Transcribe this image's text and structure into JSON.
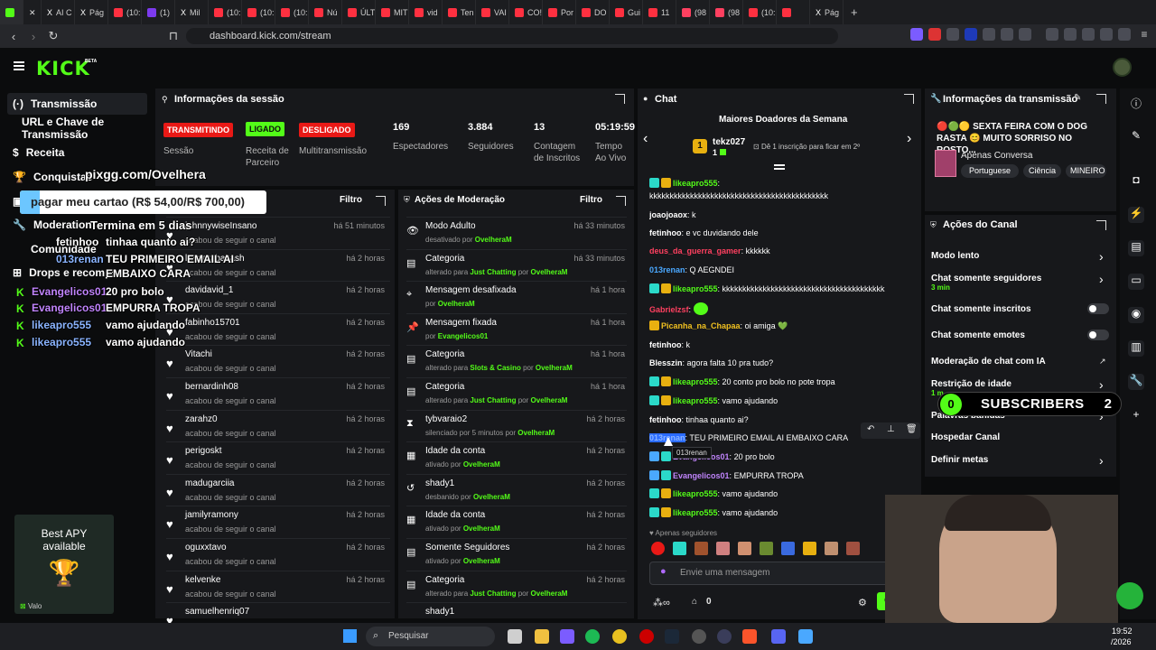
{
  "browser": {
    "tabs": [
      {
        "label": "",
        "c": "#53fc18",
        "active": true
      },
      {
        "label": "",
        "c": "#2b2c30",
        "close": "✕"
      },
      {
        "label": "AI C",
        "c": "#ffffff",
        "x": "X"
      },
      {
        "label": "Pág",
        "c": "#ffffff",
        "x": "X"
      },
      {
        "label": "(10:",
        "c": "#ff3040"
      },
      {
        "label": "(1)",
        "c": "#7c3aed"
      },
      {
        "label": "Mil",
        "c": "#ffffff",
        "x": "X"
      },
      {
        "label": "(10:",
        "c": "#ff3040"
      },
      {
        "label": "(10:",
        "c": "#ff3040"
      },
      {
        "label": "(10:",
        "c": "#ff3040"
      },
      {
        "label": "Nú",
        "c": "#ff3040"
      },
      {
        "label": "ÚLT",
        "c": "#ff3040"
      },
      {
        "label": "MIT",
        "c": "#ff3040"
      },
      {
        "label": "vid",
        "c": "#ff3040"
      },
      {
        "label": "Ten",
        "c": "#ff3040"
      },
      {
        "label": "VAI",
        "c": "#ff3040"
      },
      {
        "label": "CO!",
        "c": "#ff3040"
      },
      {
        "label": "Por",
        "c": "#ff3040"
      },
      {
        "label": "DO",
        "c": "#ff3040"
      },
      {
        "label": "Gui",
        "c": "#ff3040"
      },
      {
        "label": "11",
        "c": "#ff3040"
      },
      {
        "label": "(98",
        "c": "#ff4060"
      },
      {
        "label": "(98",
        "c": "#ff4060"
      },
      {
        "label": "(10:",
        "c": "#ff3040"
      },
      {
        "label": "",
        "c": "#ff3040"
      },
      {
        "label": "Pág",
        "c": "#ffffff",
        "x": "X"
      }
    ],
    "new_tab": "+",
    "url": "dashboard.kick.com/stream"
  },
  "kick": {
    "logo": "KICK",
    "beta": "BETA"
  },
  "sidebar": {
    "items": [
      {
        "label": "Transmissão",
        "icon": "(·)"
      },
      {
        "label": "URL e Chave de Transmissão",
        "icon": ""
      },
      {
        "label": "Receita",
        "icon": "$"
      },
      {
        "label": "Conquistas",
        "icon": "🏆"
      },
      {
        "label": "",
        "icon": "▣"
      },
      {
        "label": "Moderation",
        "icon": "🔧"
      },
      {
        "label": "Comunidade",
        "icon": ""
      },
      {
        "label": "Drops e recompe",
        "icon": "⊞"
      }
    ]
  },
  "overlay": {
    "link": "pixgg.com/Ovelhera",
    "goal": "pagar meu cartao (R$ 54,00/R$ 700,00)",
    "ends": "Termina em 5 dias",
    "chat": [
      {
        "user": "fetinhoo",
        "msg": "tinhaa quanto ai?",
        "color": "#ffffff"
      },
      {
        "user": "013renan",
        "msg": "TEU PRIMEIRO EMAIL AI",
        "color": "#8ab4ff"
      },
      {
        "user": "",
        "msg": "EMBAIXO CARA",
        "color": "#ffffff"
      },
      {
        "user": "Evangelicos01",
        "msg": "20 pro bolo",
        "color": "#c084fc"
      },
      {
        "user": "Evangelicos01",
        "msg": "EMPURRA TROPA",
        "color": "#c084fc"
      },
      {
        "user": "likeapro555",
        "msg": "vamo ajudando",
        "color": "#8ab4ff"
      },
      {
        "user": "likeapro555",
        "msg": "vamo ajudando",
        "color": "#8ab4ff"
      }
    ],
    "apy_line1": "Best APY",
    "apy_line2": "available",
    "valo": "Valo",
    "viewers": "169",
    "sub_count_left": "0",
    "sub_label": "SUBSCRIBERS",
    "sub_count_right": "2"
  },
  "session": {
    "title": "Informações da sessão",
    "badges": {
      "live": "TRANSMITINDO",
      "on": "LIGADO",
      "off": "DESLIGADO"
    },
    "labels": {
      "session": "Sessão",
      "partner": "Receita de Parceiro",
      "multi": "Multitransmissão"
    },
    "stats": [
      {
        "value": "169",
        "label": "Espectadores"
      },
      {
        "value": "3.884",
        "label": "Seguidores"
      },
      {
        "value": "13",
        "label": "Contagem de Inscritos"
      },
      {
        "value": "05:19:59",
        "label": "Tempo Ao Vivo"
      }
    ]
  },
  "followers": {
    "filter": "Filtro",
    "rows": [
      {
        "name": "johnnywiseInsano",
        "sub": "acabou de seguir o canal",
        "time": "há 51 minutos"
      },
      {
        "name": "lanaarabakash",
        "sub": "acabou de seguir o canal",
        "time": "há 2 horas"
      },
      {
        "name": "davidavid_1",
        "sub": "acabou de seguir o canal",
        "time": "há 2 horas"
      },
      {
        "name": "fabinho15701",
        "sub": "acabou de seguir o canal",
        "time": "há 2 horas"
      },
      {
        "name": "Vitachi",
        "sub": "acabou de seguir o canal",
        "time": "há 2 horas"
      },
      {
        "name": "bernardinh08",
        "sub": "acabou de seguir o canal",
        "time": "há 2 horas"
      },
      {
        "name": "zarahz0",
        "sub": "acabou de seguir o canal",
        "time": "há 2 horas"
      },
      {
        "name": "perigoskt",
        "sub": "acabou de seguir o canal",
        "time": "há 2 horas"
      },
      {
        "name": "madugarciia",
        "sub": "acabou de seguir o canal",
        "time": "há 2 horas"
      },
      {
        "name": "jamilyramony",
        "sub": "acabou de seguir o canal",
        "time": "há 2 horas"
      },
      {
        "name": "oguxxtavo",
        "sub": "acabou de seguir o canal",
        "time": "há 2 horas"
      },
      {
        "name": "kelvenke",
        "sub": "acabou de seguir o canal",
        "time": "há 2 horas"
      },
      {
        "name": "samuelhenriq07",
        "sub": "",
        "time": ""
      }
    ]
  },
  "moderation": {
    "title": "Ações de Moderação",
    "filter": "Filtro",
    "rows": [
      {
        "icon": "👁",
        "name": "Modo Adulto",
        "pre": "desativado por",
        "hl": "",
        "mid": "",
        "by": "OvelheraM",
        "time": "há 33 minutos"
      },
      {
        "icon": "▤",
        "name": "Categoria",
        "pre": "alterado para",
        "hl": "Just Chatting",
        "mid": "por",
        "by": "OvelheraM",
        "time": "há 33 minutos"
      },
      {
        "icon": "⌖",
        "name": "Mensagem desafixada",
        "pre": "por",
        "hl": "",
        "mid": "",
        "by": "OvelheraM",
        "time": "há 1 hora"
      },
      {
        "icon": "📌",
        "name": "Mensagem fixada",
        "pre": "por",
        "hl": "",
        "mid": "",
        "by": "Evangelicos01",
        "time": "há 1 hora"
      },
      {
        "icon": "▤",
        "name": "Categoria",
        "pre": "alterado para",
        "hl": "Slots & Casino",
        "mid": "por",
        "by": "OvelheraM",
        "time": "há 1 hora"
      },
      {
        "icon": "▤",
        "name": "Categoria",
        "pre": "alterado para",
        "hl": "Just Chatting",
        "mid": "por",
        "by": "OvelheraM",
        "time": "há 1 hora"
      },
      {
        "icon": "⧗",
        "name": "tybvaraio2",
        "pre": "silenciado por 5 minutos por",
        "hl": "",
        "mid": "",
        "by": "OvelheraM",
        "time": "há 2 horas"
      },
      {
        "icon": "▦",
        "name": "Idade da conta",
        "pre": "ativado por",
        "hl": "",
        "mid": "",
        "by": "OvelheraM",
        "time": "há 2 horas"
      },
      {
        "icon": "↺",
        "name": "shady1",
        "pre": "desbanido por",
        "hl": "",
        "mid": "",
        "by": "OvelheraM",
        "time": "há 2 horas"
      },
      {
        "icon": "▦",
        "name": "Idade da conta",
        "pre": "ativado por",
        "hl": "",
        "mid": "",
        "by": "OvelheraM",
        "time": "há 2 horas"
      },
      {
        "icon": "▤",
        "name": "Somente Seguidores",
        "pre": "ativado por",
        "hl": "",
        "mid": "",
        "by": "OvelheraM",
        "time": "há 2 horas"
      },
      {
        "icon": "▤",
        "name": "Categoria",
        "pre": "alterado para",
        "hl": "Just Chatting",
        "mid": "por",
        "by": "OvelheraM",
        "time": "há 2 horas"
      },
      {
        "icon": "",
        "name": "shady1",
        "pre": "",
        "hl": "",
        "mid": "",
        "by": "",
        "time": ""
      }
    ]
  },
  "chat": {
    "title": "Chat",
    "donors_title": "Maiores Doadores da Semana",
    "donor_rank": "1",
    "donor_name": "tekz027",
    "donor_count": "1",
    "donor_info": "Dê 1 inscrição para ficar em 2º",
    "messages": [
      {
        "user": "likeapro555",
        "color": "#53fc18",
        "badges": [
          "#2bd9c9",
          "#e8b010"
        ],
        "text": ""
      },
      {
        "user": "",
        "color": "#fff",
        "badges": [],
        "text": "kkkkkkkkkkkkkkkkkkkkkkkkkkkkkkkkkkkkkkkkkkkk"
      },
      {
        "user": "joaojoaox",
        "color": "#ffffff",
        "badges": [],
        "text": "k"
      },
      {
        "user": "fetinhoo",
        "color": "#ffffff",
        "badges": [],
        "text": "e vc duvidando dele"
      },
      {
        "user": "deus_da_guerra_gamer",
        "color": "#ff4060",
        "badges": [],
        "text": "kkkkkk"
      },
      {
        "user": "013renan",
        "color": "#4aa8ff",
        "badges": [],
        "text": "Q AEGNDEI"
      },
      {
        "user": "likeapro555",
        "color": "#53fc18",
        "badges": [
          "#2bd9c9",
          "#e8b010"
        ],
        "text": "kkkkkkkkkkkkkkkkkkkkkkkkkkkkkkkkkkkkkkkk"
      },
      {
        "user": "Gabrielzsf",
        "color": "#ff4060",
        "badges": [],
        "text": ""
      },
      {
        "user": "Picanha_na_Chapaa",
        "color": "#f0c020",
        "badges": [
          "#e8b010"
        ],
        "text": "oi amiga 💚"
      },
      {
        "user": "fetinhoo",
        "color": "#ffffff",
        "badges": [],
        "text": "k"
      },
      {
        "user": "Blesszin",
        "color": "#ffffff",
        "badges": [],
        "text": "agora falta 10 pra tudo?"
      },
      {
        "user": "likeapro555",
        "color": "#53fc18",
        "badges": [
          "#2bd9c9",
          "#e8b010"
        ],
        "text": "20 conto pro bolo no pote tropa"
      },
      {
        "user": "likeapro555",
        "color": "#53fc18",
        "badges": [
          "#2bd9c9",
          "#e8b010"
        ],
        "text": "vamo ajudando"
      },
      {
        "user": "fetinhoo",
        "color": "#ffffff",
        "badges": [],
        "text": "tinhaa quanto ai?"
      },
      {
        "user": "013renan",
        "color": "#4aa8ff",
        "badges": [],
        "text": "TEU PRIMEIRO EMAIL AI EMBAIXO CARA"
      },
      {
        "user": "Evangelicos01",
        "color": "#c084fc",
        "badges": [
          "#4aa8ff",
          "#2bd9c9"
        ],
        "text": "20 pro bolo"
      },
      {
        "user": "Evangelicos01",
        "color": "#c084fc",
        "badges": [
          "#4aa8ff",
          "#2bd9c9"
        ],
        "text": "EMPURRA TROPA"
      },
      {
        "user": "likeapro555",
        "color": "#53fc18",
        "badges": [
          "#2bd9c9",
          "#e8b010"
        ],
        "text": "vamo ajudando"
      },
      {
        "user": "likeapro555",
        "color": "#53fc18",
        "badges": [
          "#2bd9c9",
          "#e8b010"
        ],
        "text": "vamo ajudando"
      }
    ],
    "tooltip": "013renan",
    "emotes_label": "Apenas seguidores",
    "placeholder": "Envie uma mensagem",
    "points": "0",
    "send": "Chat"
  },
  "stream_info": {
    "title": "Informações da transmissão",
    "stream_title": "🔴🟢🟡 SEXTA FEIRA COM O DOG RASTA 😊 MUITO SORRISO NO ROSTO...",
    "category": "Apenas Conversa",
    "tags": [
      "Portuguese",
      "Ciência",
      "MINEIRO"
    ]
  },
  "channel_actions": {
    "title": "Ações do Canal",
    "items": [
      {
        "label": "Modo lento",
        "kind": "chev"
      },
      {
        "label": "Chat somente seguidores",
        "sub": "3 min",
        "kind": "chev"
      },
      {
        "label": "Chat somente inscritos",
        "kind": "toggle"
      },
      {
        "label": "Chat somente emotes",
        "kind": "toggle"
      },
      {
        "label": "Moderação de chat com IA",
        "kind": "ext"
      },
      {
        "label": "Restrição de idade",
        "sub": "1 m",
        "kind": "chev"
      },
      {
        "label": "Palavras banidas",
        "kind": "chev"
      },
      {
        "label": "Hospedar Canal",
        "kind": "none"
      },
      {
        "label": "Definir metas",
        "kind": "chev"
      }
    ]
  },
  "taskbar": {
    "search": "Pesquisar",
    "time": "19:52",
    "date": "/2026"
  },
  "colors": {
    "kick_green": "#53fc18",
    "badge_red": "#e91916",
    "panel": "#17181b"
  }
}
